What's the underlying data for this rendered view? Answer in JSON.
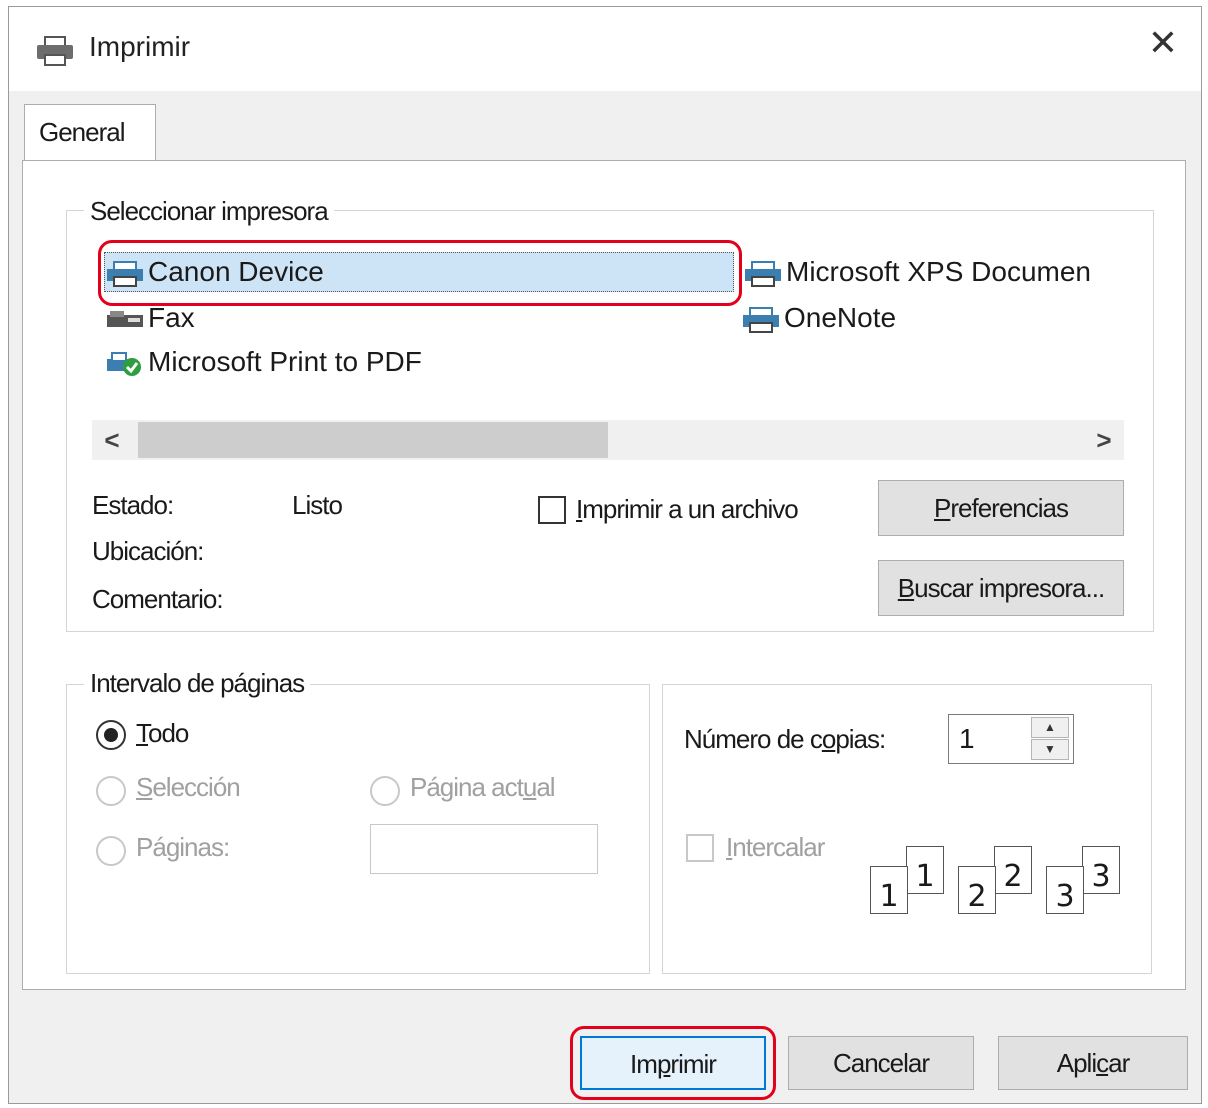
{
  "window": {
    "title": "Imprimir",
    "close_glyph": "✕"
  },
  "tabs": [
    {
      "label": "General",
      "active": true
    }
  ],
  "printer_group": {
    "legend": "Seleccionar impresora",
    "printers": [
      {
        "name": "Canon Device",
        "icon": "printer-icon",
        "selected": true
      },
      {
        "name": "Microsoft XPS Documen",
        "icon": "printer-icon"
      },
      {
        "name": "Fax",
        "icon": "fax-icon"
      },
      {
        "name": "OneNote",
        "icon": "printer-icon"
      },
      {
        "name": "Microsoft Print to PDF",
        "icon": "default-printer-icon"
      }
    ],
    "scroll_left": "<",
    "scroll_right": ">",
    "status_label": "Estado:",
    "status_value": "Listo",
    "location_label": "Ubicación:",
    "comment_label": "Comentario:",
    "print_to_file": {
      "pre": "",
      "ul": "I",
      "post": "mprimir a un archivo",
      "checked": false
    },
    "preferences_button": {
      "pre": "",
      "ul": "P",
      "post": "referencias"
    },
    "find_printer_button": {
      "pre": "",
      "ul": "B",
      "post": "uscar impresora..."
    }
  },
  "page_range_group": {
    "legend": "Intervalo de páginas",
    "all": {
      "pre": "",
      "ul": "T",
      "post": "odo",
      "selected": true
    },
    "selection": {
      "pre": "",
      "ul": "S",
      "post": "elección",
      "enabled": false
    },
    "current_page": {
      "pre": "Página act",
      "ul": "u",
      "post": "al",
      "enabled": false
    },
    "pages": {
      "pre": "Pá",
      "ul": "g",
      "post": "inas:",
      "enabled": false
    }
  },
  "copies_group": {
    "copies_label": {
      "pre": "Número de c",
      "ul": "o",
      "post": "pias:"
    },
    "copies_value": "1",
    "collate": {
      "pre": "",
      "ul": "I",
      "post": "ntercalar",
      "checked": false,
      "enabled": false
    },
    "collate_numbers": [
      "1",
      "2",
      "3"
    ]
  },
  "buttons": {
    "print": {
      "pre": "Im",
      "ul": "p",
      "post": "rimir"
    },
    "cancel": {
      "label": "Cancelar"
    },
    "apply": {
      "pre": "Apli",
      "ul": "c",
      "post": "ar"
    }
  },
  "colors": {
    "highlight": "#e2001a",
    "selection_bg": "#cde4f7",
    "dialog_bg": "#f0f0f0"
  }
}
